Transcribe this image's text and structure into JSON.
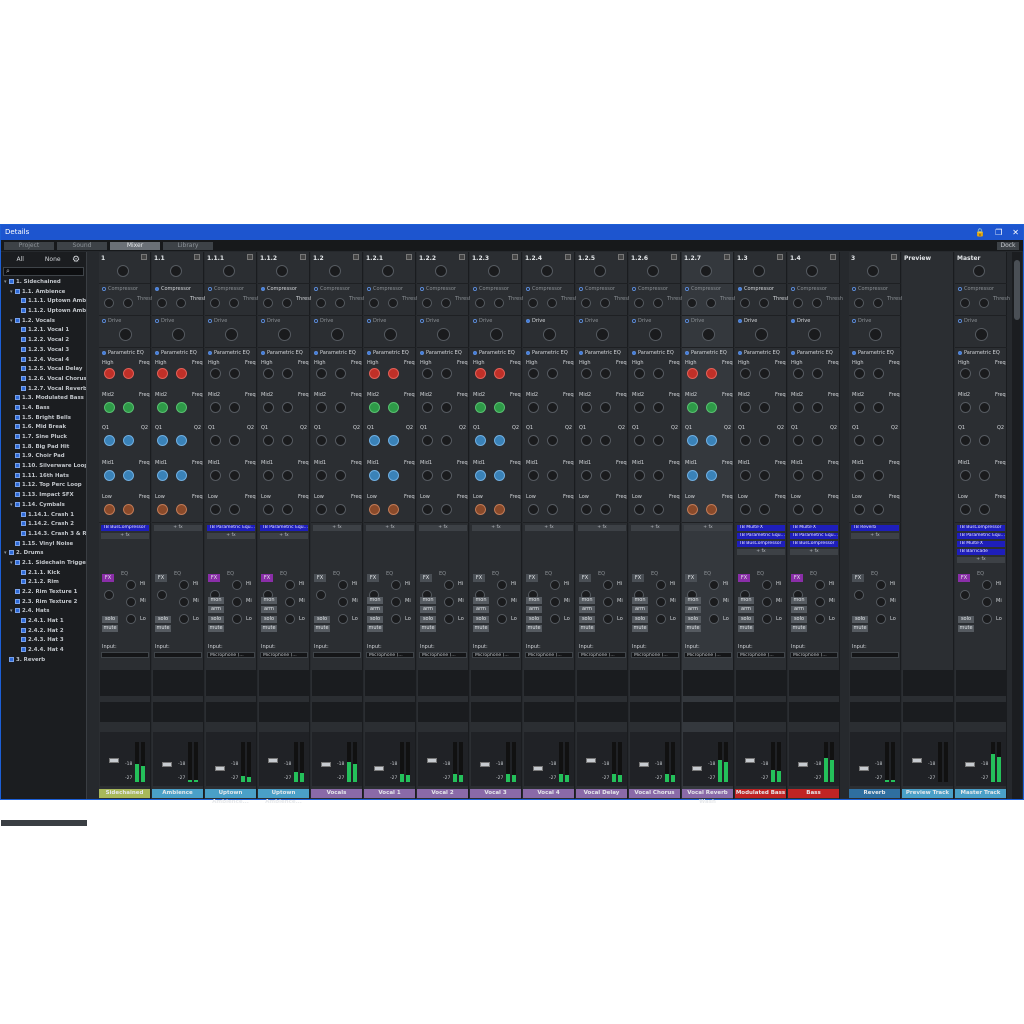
{
  "window": {
    "title": "Details"
  },
  "tabs": [
    {
      "label": "Project"
    },
    {
      "label": "Sound"
    },
    {
      "label": "Mixer"
    },
    {
      "label": "Library"
    }
  ],
  "dock_label": "Dock",
  "sidebar": {
    "all": "All",
    "none": "None",
    "tree": [
      {
        "label": "1. Sidechained",
        "level": 0,
        "exp": true
      },
      {
        "label": "1.1. Ambience",
        "level": 1,
        "exp": true
      },
      {
        "label": "1.1.1. Uptown Ambi...",
        "level": 2
      },
      {
        "label": "1.1.2. Uptown Ambi...",
        "level": 2
      },
      {
        "label": "1.2. Vocals",
        "level": 1,
        "exp": true
      },
      {
        "label": "1.2.1. Vocal 1",
        "level": 2
      },
      {
        "label": "1.2.2. Vocal 2",
        "level": 2
      },
      {
        "label": "1.2.3. Vocal 3",
        "level": 2
      },
      {
        "label": "1.2.4. Vocal 4",
        "level": 2
      },
      {
        "label": "1.2.5. Vocal Delay",
        "level": 2
      },
      {
        "label": "1.2.6. Vocal Chorus",
        "level": 2
      },
      {
        "label": "1.2.7. Vocal Reverb ...",
        "level": 2
      },
      {
        "label": "1.3. Modulated Bass",
        "level": 1
      },
      {
        "label": "1.4. Bass",
        "level": 1
      },
      {
        "label": "1.5. Bright Bells",
        "level": 1
      },
      {
        "label": "1.6. Mid Break",
        "level": 1
      },
      {
        "label": "1.7. Sine Pluck",
        "level": 1
      },
      {
        "label": "1.8. Big Pad Hit",
        "level": 1
      },
      {
        "label": "1.9. Choir Pad",
        "level": 1
      },
      {
        "label": "1.10. Silverware Loop",
        "level": 1
      },
      {
        "label": "1.11. 16th Hats",
        "level": 1
      },
      {
        "label": "1.12. Top Perc Loop",
        "level": 1
      },
      {
        "label": "1.13. Impact SFX",
        "level": 1
      },
      {
        "label": "1.14. Cymbals",
        "level": 1,
        "exp": true
      },
      {
        "label": "1.14.1. Crash 1",
        "level": 2
      },
      {
        "label": "1.14.2. Crash 2",
        "level": 2
      },
      {
        "label": "1.14.3. Crash 3 & Rev",
        "level": 2
      },
      {
        "label": "1.15. Vinyl Noise",
        "level": 1
      },
      {
        "label": "2. Drums",
        "level": 0,
        "exp": true
      },
      {
        "label": "2.1. Sidechain Trigger",
        "level": 1,
        "exp": true
      },
      {
        "label": "2.1.1. Kick",
        "level": 2
      },
      {
        "label": "2.1.2. Rim",
        "level": 2
      },
      {
        "label": "2.2. Rim Texture 1",
        "level": 1
      },
      {
        "label": "2.3. Rim Texture 2",
        "level": 1
      },
      {
        "label": "2.4. Hats",
        "level": 1,
        "exp": true
      },
      {
        "label": "2.4.1. Hat 1",
        "level": 2
      },
      {
        "label": "2.4.2. Hat 2",
        "level": 2
      },
      {
        "label": "2.4.3. Hat 3",
        "level": 2
      },
      {
        "label": "2.4.4. Hat 4",
        "level": 2
      },
      {
        "label": "3. Reverb",
        "level": 0
      }
    ]
  },
  "labels": {
    "compressor": "Compressor",
    "thresh": "Thresh",
    "drive": "Drive",
    "peq": "Parametric EQ",
    "high": "High",
    "freq": "Freq",
    "mid2": "Mid2",
    "q1": "Q1",
    "q2": "Q2",
    "mid1": "Mid1",
    "low": "Low",
    "addfx": "+ fx",
    "fx": "FX",
    "eq": "EQ",
    "hi": "Hi",
    "mi": "Mi",
    "lo": "Lo",
    "solo": "solo",
    "mute": "mute",
    "mon": "mon",
    "arm": "arm",
    "input": "Input:",
    "db": "-18",
    "db2": "-27"
  },
  "strips": [
    {
      "num": "1",
      "name": "Sidechained",
      "color": "#a8b85a",
      "fx": [
        "TB BusCompressor"
      ],
      "fxon": true,
      "knobs": "red",
      "rec": false,
      "meter": 0.45
    },
    {
      "num": "1.1",
      "name": "Ambience",
      "color": "#4aa0c8",
      "fx": [],
      "fxon": false,
      "knobs": "red",
      "comp": true,
      "rec": false,
      "meter": 0.05
    },
    {
      "num": "1.1.1",
      "name": "Uptown Ambience...",
      "color": "#4aa0c8",
      "fx": [
        "TB Parametric Equ..."
      ],
      "fxon": true,
      "knobs": "dark",
      "rec": true,
      "input": "Microphone (...",
      "meter": 0.15
    },
    {
      "num": "1.1.2",
      "name": "Uptown Ambience...",
      "color": "#4aa0c8",
      "fx": [
        "TB Parametric Equ..."
      ],
      "fxon": true,
      "knobs": "dark",
      "comp": true,
      "rec": true,
      "input": "Microphone (...",
      "meter": 0.25
    },
    {
      "num": "1.2",
      "name": "Vocals",
      "color": "#8a6aa8",
      "fx": [],
      "fxon": false,
      "knobs": "dark",
      "rec": false,
      "meter": 0.5
    },
    {
      "num": "1.2.1",
      "name": "Vocal 1",
      "color": "#8a6aa8",
      "fx": [],
      "fxon": false,
      "knobs": "red",
      "rec": true,
      "input": "Microphone (...",
      "meter": 0.2
    },
    {
      "num": "1.2.2",
      "name": "Vocal 2",
      "color": "#8a6aa8",
      "fx": [],
      "fxon": false,
      "knobs": "dark",
      "rec": true,
      "input": "Microphone (...",
      "meter": 0.2
    },
    {
      "num": "1.2.3",
      "name": "Vocal 3",
      "color": "#8a6aa8",
      "fx": [],
      "fxon": false,
      "knobs": "red",
      "rec": true,
      "input": "Microphone (...",
      "meter": 0.2
    },
    {
      "num": "1.2.4",
      "name": "Vocal 4",
      "color": "#8a6aa8",
      "fx": [],
      "fxon": false,
      "knobs": "dark",
      "drive": true,
      "rec": true,
      "input": "Microphone (...",
      "meter": 0.2
    },
    {
      "num": "1.2.5",
      "name": "Vocal Delay",
      "color": "#8a6aa8",
      "fx": [],
      "fxon": false,
      "knobs": "dark",
      "rec": true,
      "input": "Microphone (...",
      "meter": 0.2
    },
    {
      "num": "1.2.6",
      "name": "Vocal Chorus",
      "color": "#8a6aa8",
      "fx": [],
      "fxon": false,
      "knobs": "dark",
      "rec": true,
      "input": "Microphone (...",
      "meter": 0.2
    },
    {
      "num": "1.2.7",
      "name": "Vocal Reverb Wash",
      "color": "#8a6aa8",
      "fx": [],
      "fxon": false,
      "knobs": "red",
      "sel": true,
      "rec": true,
      "input": "Microphone (...",
      "meter": 0.55
    },
    {
      "num": "1.3",
      "name": "Modulated Bass",
      "color": "#c02424",
      "fx": [
        "TB MultiFX",
        "TB Parametric Equ...",
        "TB BusCompressor"
      ],
      "fxon": true,
      "knobs": "dark",
      "comp": true,
      "drive": true,
      "rec": true,
      "input": "Microphone (...",
      "meter": 0.3
    },
    {
      "num": "1.4",
      "name": "Bass",
      "color": "#c02424",
      "fx": [
        "TB MultiFX",
        "TB Parametric Equ...",
        "TB BusCompressor"
      ],
      "fxon": true,
      "knobs": "dark",
      "drive": true,
      "rec": true,
      "input": "Microphone (...",
      "meter": 0.6
    },
    {
      "num": "3",
      "name": "Reverb",
      "color": "#2f6fa0",
      "fx": [
        "TB Reverb"
      ],
      "fxon": false,
      "knobs": "dark",
      "rec": false,
      "meter": 0.05,
      "gap": true
    },
    {
      "num": "Preview",
      "name": "Preview Track",
      "color": "#4aa0c8",
      "fx": [],
      "fxon": false,
      "knobs": "none",
      "rec": false,
      "meter": 0.0,
      "preview": true
    },
    {
      "num": "Master",
      "name": "Master Track",
      "color": "#4aa0c8",
      "fx": [
        "TB BusCompressor",
        "TB Parametric Equ...",
        "TB MultiFX",
        "TB Barricade"
      ],
      "fxon": true,
      "knobs": "dark",
      "rec": false,
      "meter": 0.7,
      "master": true
    }
  ]
}
